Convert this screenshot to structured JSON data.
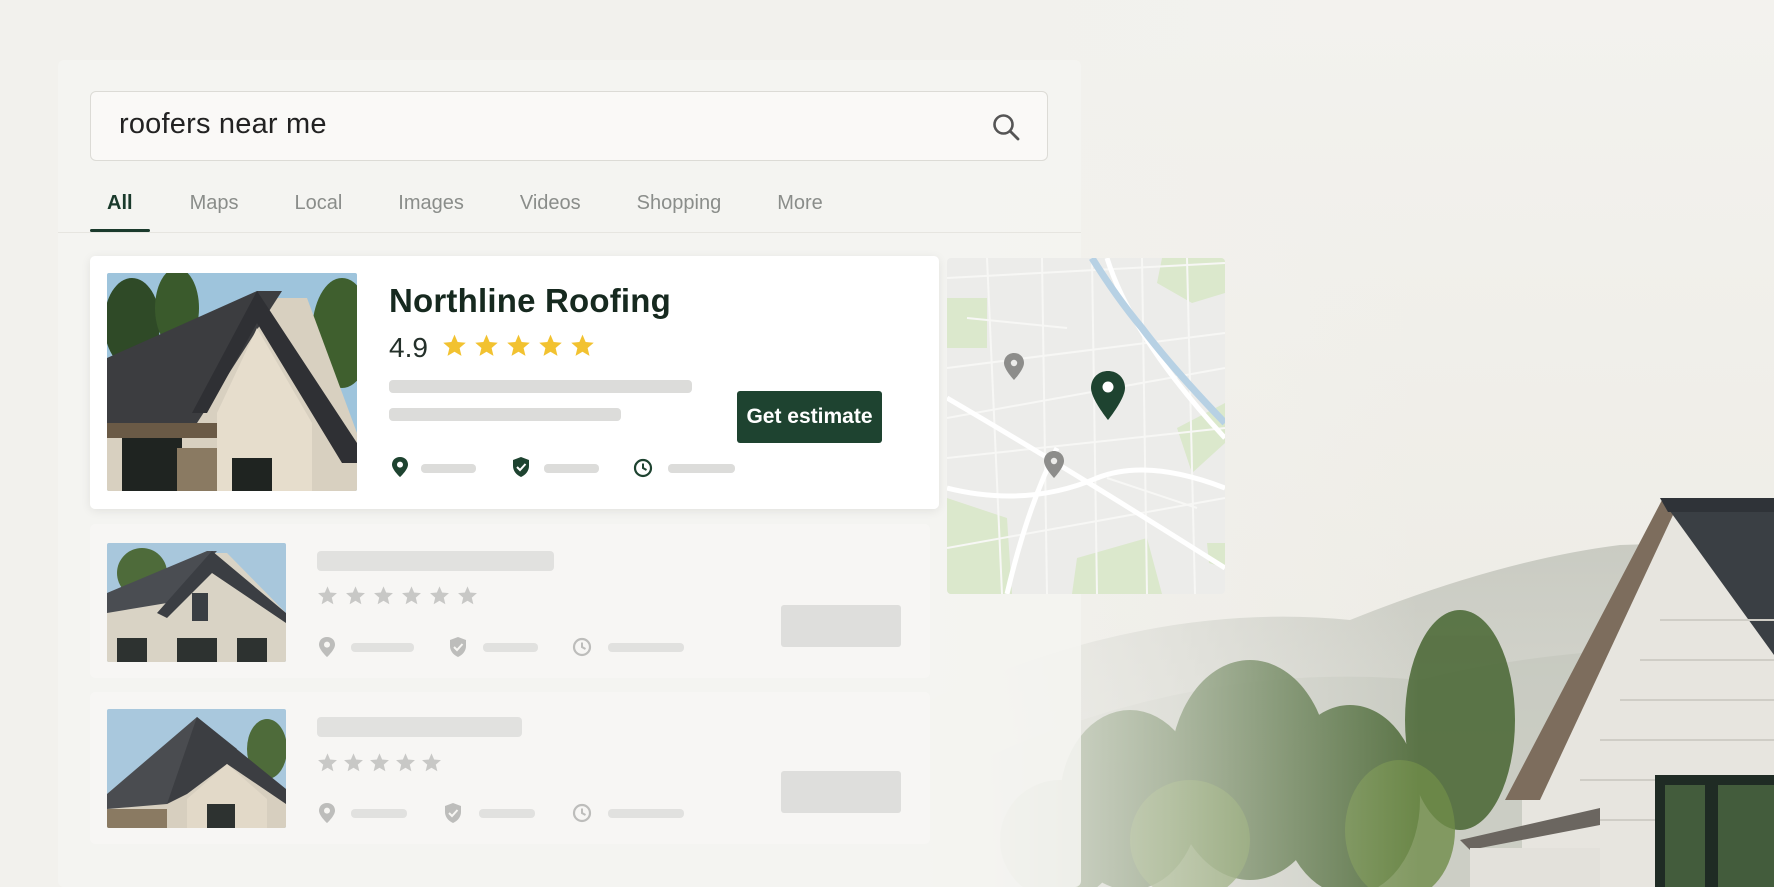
{
  "search": {
    "query": "roofers near me"
  },
  "tabs": [
    {
      "label": "All",
      "active": true
    },
    {
      "label": "Maps",
      "active": false
    },
    {
      "label": "Local",
      "active": false
    },
    {
      "label": "Images",
      "active": false
    },
    {
      "label": "Videos",
      "active": false
    },
    {
      "label": "Shopping",
      "active": false
    },
    {
      "label": "More",
      "active": false
    }
  ],
  "featured_result": {
    "name": "Northline Roofing",
    "rating": "4.9",
    "stars": 5,
    "cta_label": "Get estimate",
    "meta_icons": [
      "location-pin-icon",
      "shield-check-icon",
      "clock-icon"
    ]
  },
  "placeholder_results": [
    {
      "stars_shown": 6,
      "meta_icons": [
        "location-pin-icon",
        "shield-check-icon",
        "clock-icon"
      ]
    },
    {
      "stars_shown": 5,
      "meta_icons": [
        "location-pin-icon",
        "shield-check-icon",
        "clock-icon"
      ]
    }
  ],
  "map": {
    "pins": [
      "map-pin-icon",
      "map-pin-icon",
      "selected-map-pin-icon"
    ]
  },
  "colors": {
    "brand": "#1e4330",
    "star": "#f2c230",
    "ghost_star": "#c8c8c6"
  }
}
